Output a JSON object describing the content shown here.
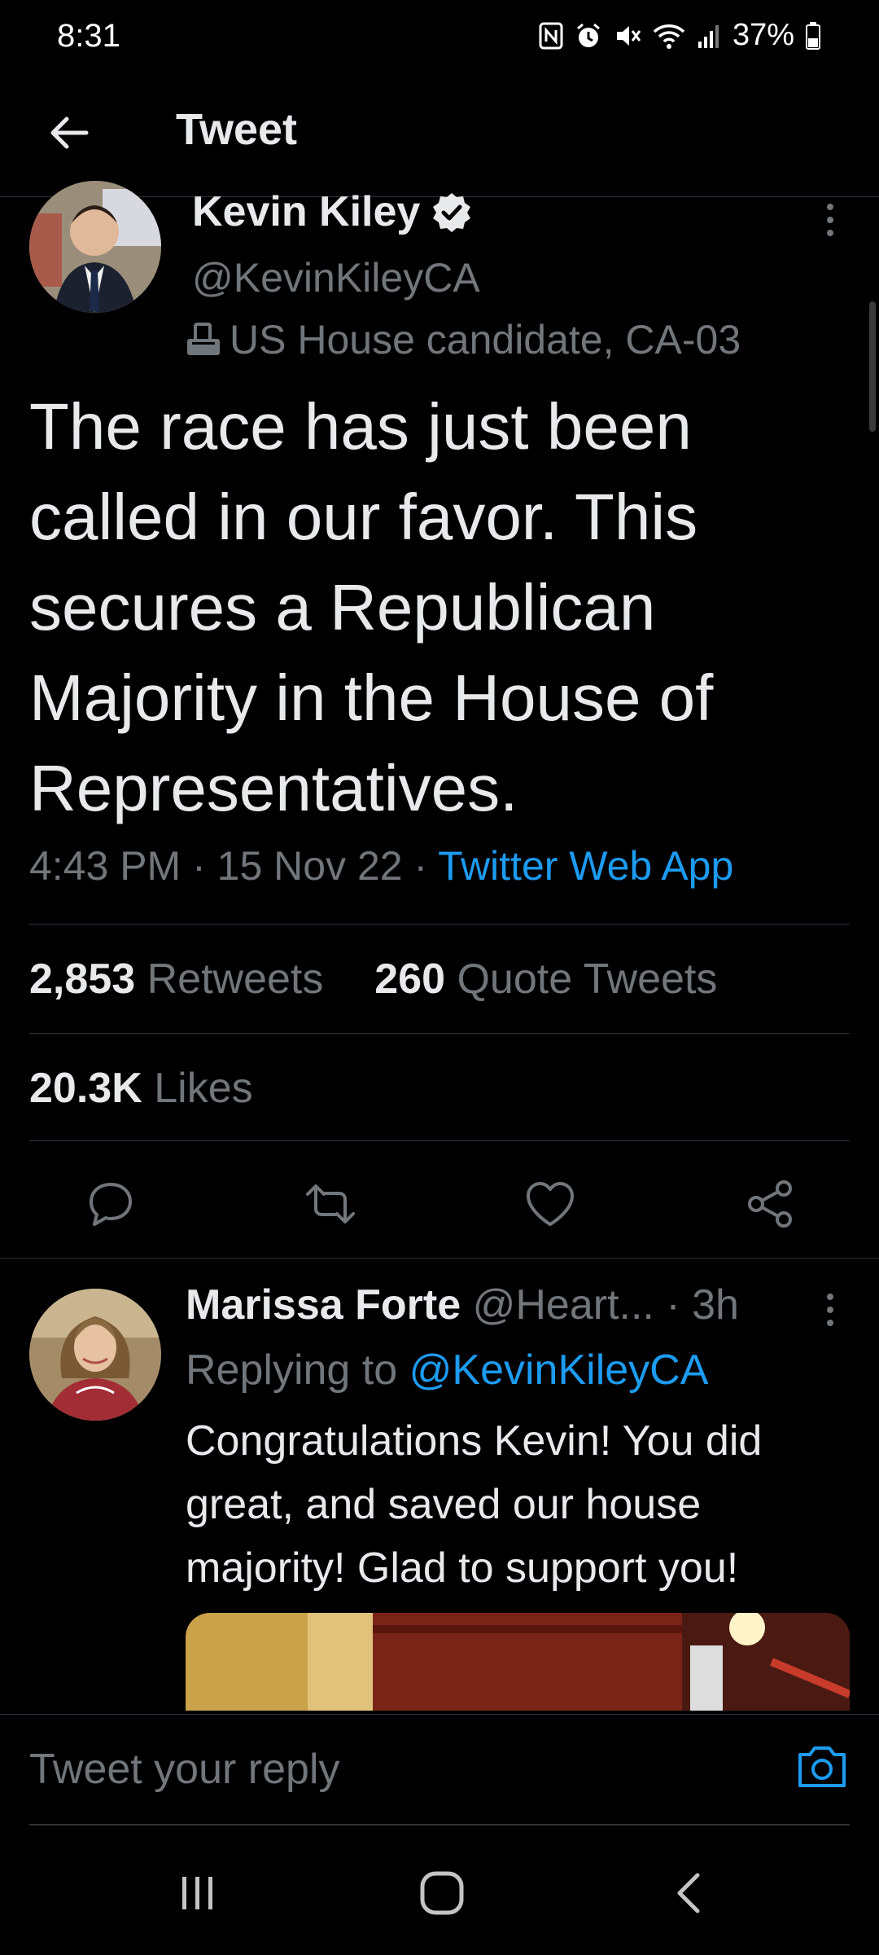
{
  "status_bar": {
    "time": "8:31",
    "battery": "37%"
  },
  "header": {
    "title": "Tweet"
  },
  "tweet": {
    "author_name": "Kevin Kiley",
    "author_handle": "@KevinKileyCA",
    "author_label": "US House candidate, CA-03",
    "text": "The race has just been called in our favor. This secures a Republican Majority in the House of Representatives.",
    "time": "4:43 PM",
    "date": "15 Nov 22",
    "source": "Twitter Web App",
    "retweets_count": "2,853",
    "retweets_label": "Retweets",
    "quotes_count": "260",
    "quotes_label": "Quote Tweets",
    "likes_count": "20.3K",
    "likes_label": "Likes"
  },
  "reply": {
    "author_name": "Marissa Forte",
    "author_handle": "@Heart...",
    "age": "3h",
    "replying_prefix": "Replying to",
    "replying_to": "@KevinKileyCA",
    "text": "Congratulations Kevin! You did great, and saved our house majority! Glad to support you!"
  },
  "reply_bar": {
    "placeholder": "Tweet your reply"
  },
  "colors": {
    "accent": "#1d9bf0",
    "muted": "#71767b",
    "text": "#e7e9ea",
    "background": "#000000"
  }
}
